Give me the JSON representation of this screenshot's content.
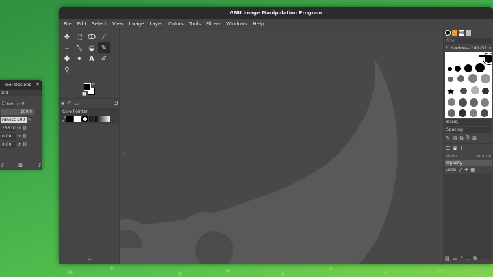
{
  "window": {
    "title": "GNU Image Manipulation Program",
    "menu": [
      "File",
      "Edit",
      "Select",
      "View",
      "Image",
      "Layer",
      "Colors",
      "Tools",
      "Filters",
      "Windows",
      "Help"
    ]
  },
  "toolbox": {
    "tools": [
      {
        "name": "move-tool-icon",
        "glyph": "✥"
      },
      {
        "name": "rect-select-icon",
        "glyph": "⬚"
      },
      {
        "name": "lasso-icon",
        "glyph": "ↀ"
      },
      {
        "name": "fuzzy-select-icon",
        "glyph": "⟋"
      },
      {
        "name": "crop-icon",
        "glyph": "⌗"
      },
      {
        "name": "warp-transform-icon",
        "glyph": "⤡"
      },
      {
        "name": "bucket-fill-icon",
        "glyph": "◒"
      },
      {
        "name": "paintbrush-icon",
        "glyph": "✎"
      },
      {
        "name": "heal-icon",
        "glyph": "✚"
      },
      {
        "name": "smudge-icon",
        "glyph": "✦"
      },
      {
        "name": "text-icon",
        "glyph": "A"
      },
      {
        "name": "color-picker-icon",
        "glyph": "✐"
      },
      {
        "name": "zoom-icon",
        "glyph": "⚲"
      },
      {
        "name": "eraser-icon",
        "glyph": "⌫"
      },
      {
        "name": "ink-icon",
        "glyph": "♆"
      },
      {
        "name": "paths-icon",
        "glyph": "⌇"
      }
    ]
  },
  "device": {
    "title": "Core Pointer"
  },
  "right": {
    "filter_placeholder": "filter",
    "brush_name": "2. Hardness 100 (51 × 51)",
    "preset": "Basic,",
    "spacing_label": "Spacing",
    "mode_label": "Mode",
    "mode_value": "Normal",
    "opacity_label": "Opacity",
    "lock_label": "Lock:"
  },
  "tool_options": {
    "title": "Tool Options",
    "sub": "ons",
    "mode_value": "Erase",
    "opacity_value": "100.0",
    "brush_value": "rdness 100",
    "size_value": "256.00",
    "ratio_value": "0.00",
    "angle_value": "0.00"
  }
}
